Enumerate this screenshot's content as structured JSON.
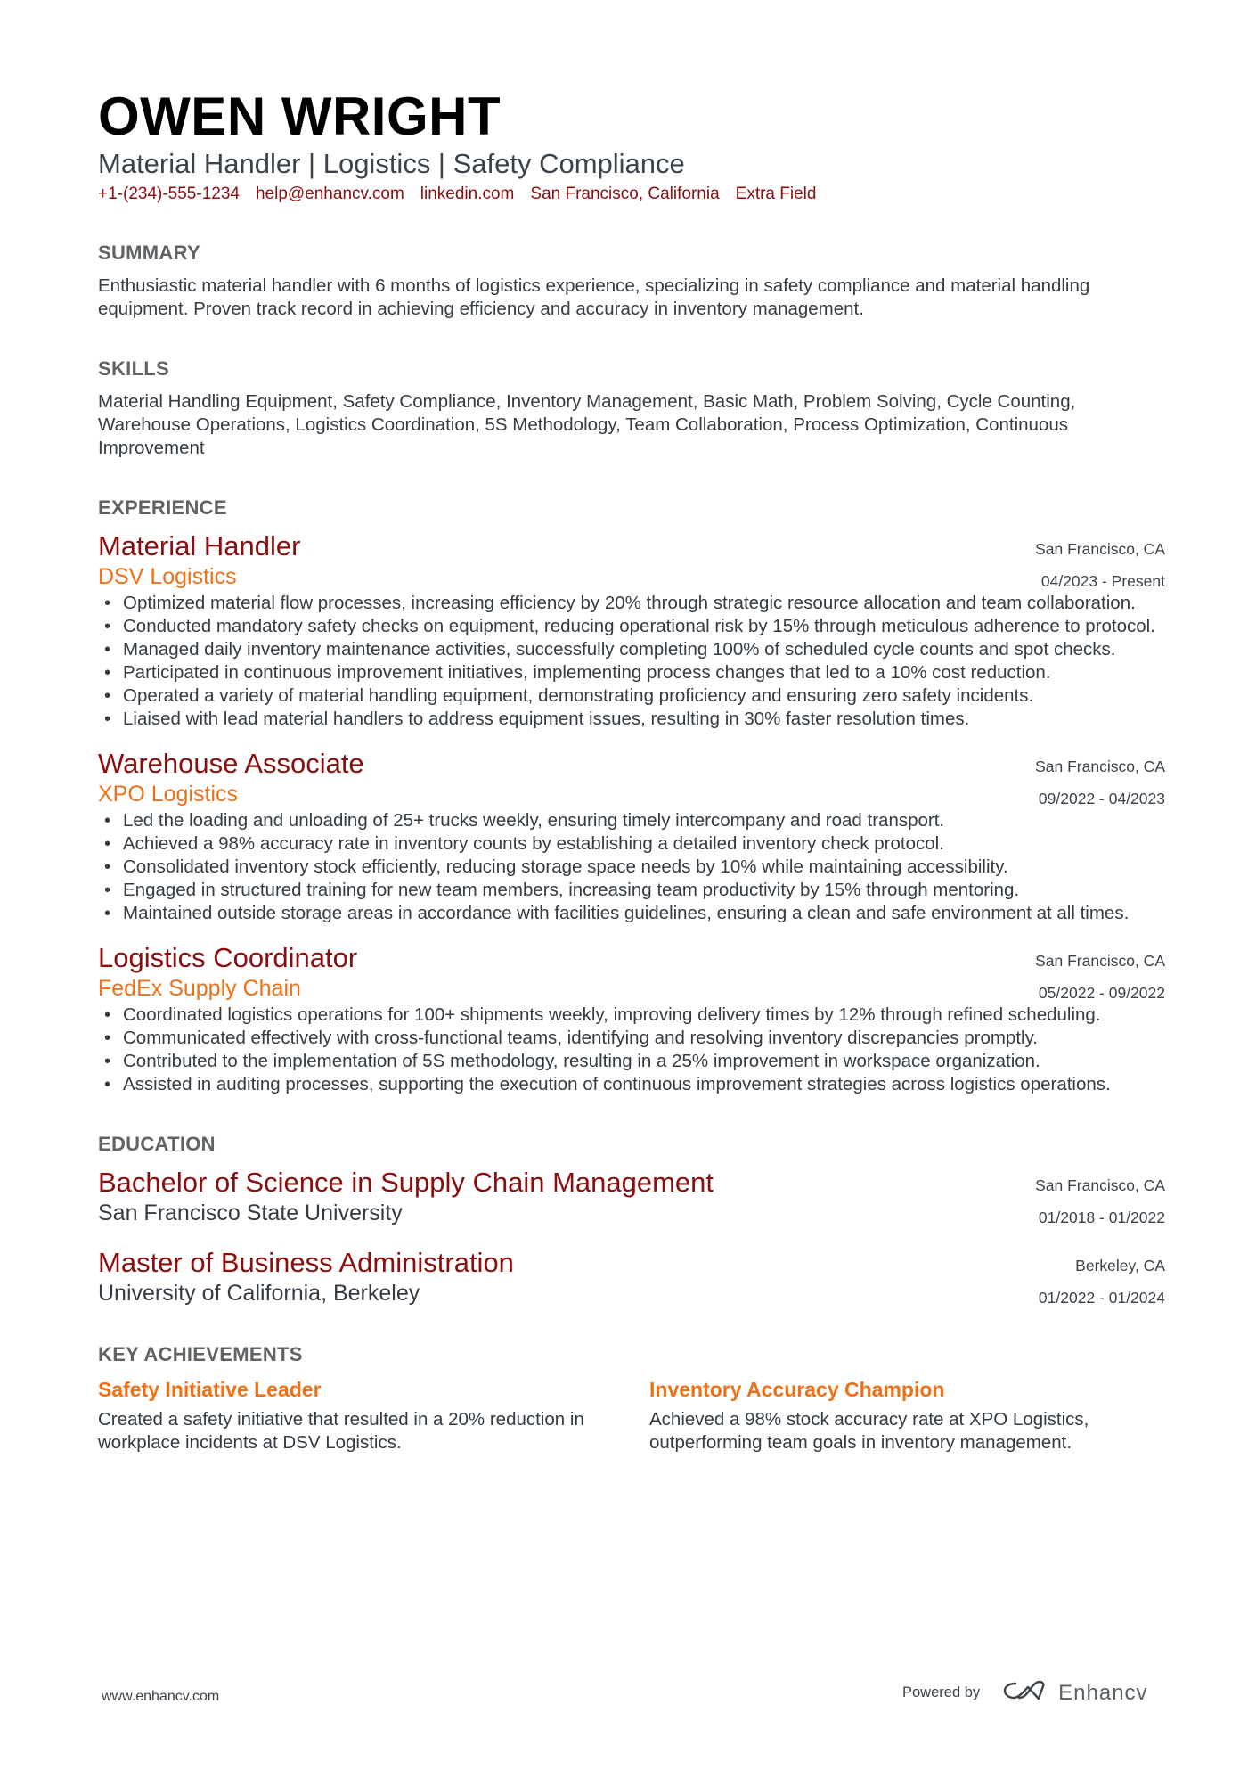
{
  "header": {
    "name": "OWEN WRIGHT",
    "headline": "Material Handler | Logistics | Safety Compliance",
    "contacts": {
      "phone": "+1-(234)-555-1234",
      "email": "help@enhancv.com",
      "linkedin": "linkedin.com",
      "location": "San Francisco, California",
      "extra": "Extra Field"
    }
  },
  "summary": {
    "title": "SUMMARY",
    "text": "Enthusiastic material handler with 6 months of logistics experience, specializing in safety compliance and material handling equipment. Proven track record in achieving efficiency and accuracy in inventory management."
  },
  "skills": {
    "title": "SKILLS",
    "text": "Material Handling Equipment, Safety Compliance, Inventory Management, Basic Math, Problem Solving, Cycle Counting, Warehouse Operations, Logistics Coordination, 5S Methodology, Team Collaboration, Process Optimization, Continuous Improvement"
  },
  "experience": {
    "title": "EXPERIENCE",
    "items": [
      {
        "role": "Material Handler",
        "company": "DSV Logistics",
        "location": "San Francisco, CA",
        "dates": "04/2023 - Present",
        "bullets": [
          "Optimized material flow processes, increasing efficiency by 20% through strategic resource allocation and team collaboration.",
          "Conducted mandatory safety checks on equipment, reducing operational risk by 15% through meticulous adherence to protocol.",
          "Managed daily inventory maintenance activities, successfully completing 100% of scheduled cycle counts and spot checks.",
          "Participated in continuous improvement initiatives, implementing process changes that led to a 10% cost reduction.",
          "Operated a variety of material handling equipment, demonstrating proficiency and ensuring zero safety incidents.",
          "Liaised with lead material handlers to address equipment issues, resulting in 30% faster resolution times."
        ]
      },
      {
        "role": "Warehouse Associate",
        "company": "XPO Logistics",
        "location": "San Francisco, CA",
        "dates": "09/2022 - 04/2023",
        "bullets": [
          "Led the loading and unloading of 25+ trucks weekly, ensuring timely intercompany and road transport.",
          "Achieved a 98% accuracy rate in inventory counts by establishing a detailed inventory check protocol.",
          "Consolidated inventory stock efficiently, reducing storage space needs by 10% while maintaining accessibility.",
          "Engaged in structured training for new team members, increasing team productivity by 15% through mentoring.",
          "Maintained outside storage areas in accordance with facilities guidelines, ensuring a clean and safe environment at all times."
        ]
      },
      {
        "role": "Logistics Coordinator",
        "company": "FedEx Supply Chain",
        "location": "San Francisco, CA",
        "dates": "05/2022 - 09/2022",
        "bullets": [
          "Coordinated logistics operations for 100+ shipments weekly, improving delivery times by 12% through refined scheduling.",
          "Communicated effectively with cross-functional teams, identifying and resolving inventory discrepancies promptly.",
          "Contributed to the implementation of 5S methodology, resulting in a 25% improvement in workspace organization.",
          "Assisted in auditing processes, supporting the execution of continuous improvement strategies across logistics operations."
        ]
      }
    ]
  },
  "education": {
    "title": "EDUCATION",
    "items": [
      {
        "degree": "Bachelor of Science in Supply Chain Management",
        "school": "San Francisco State University",
        "location": "San Francisco, CA",
        "dates": "01/2018 - 01/2022"
      },
      {
        "degree": "Master of Business Administration",
        "school": "University of California, Berkeley",
        "location": "Berkeley, CA",
        "dates": "01/2022 - 01/2024"
      }
    ]
  },
  "achievements": {
    "title": "KEY ACHIEVEMENTS",
    "items": [
      {
        "title": "Safety Initiative Leader",
        "description": "Created a safety initiative that resulted in a 20% reduction in workplace incidents at DSV Logistics."
      },
      {
        "title": "Inventory Accuracy Champion",
        "description": "Achieved a 98% stock accuracy rate at XPO Logistics, outperforming team goals in inventory management."
      }
    ]
  },
  "footer": {
    "website": "www.enhancv.com",
    "powered_by": "Powered by",
    "brand": "Enhancv",
    "logo_icon": "enhancv-infinity-heart-icon"
  },
  "colors": {
    "accent_dark_red": "#8b0d0d",
    "accent_orange": "#f07017",
    "heading_gray": "#5f6366",
    "body_text": "#333c44"
  }
}
